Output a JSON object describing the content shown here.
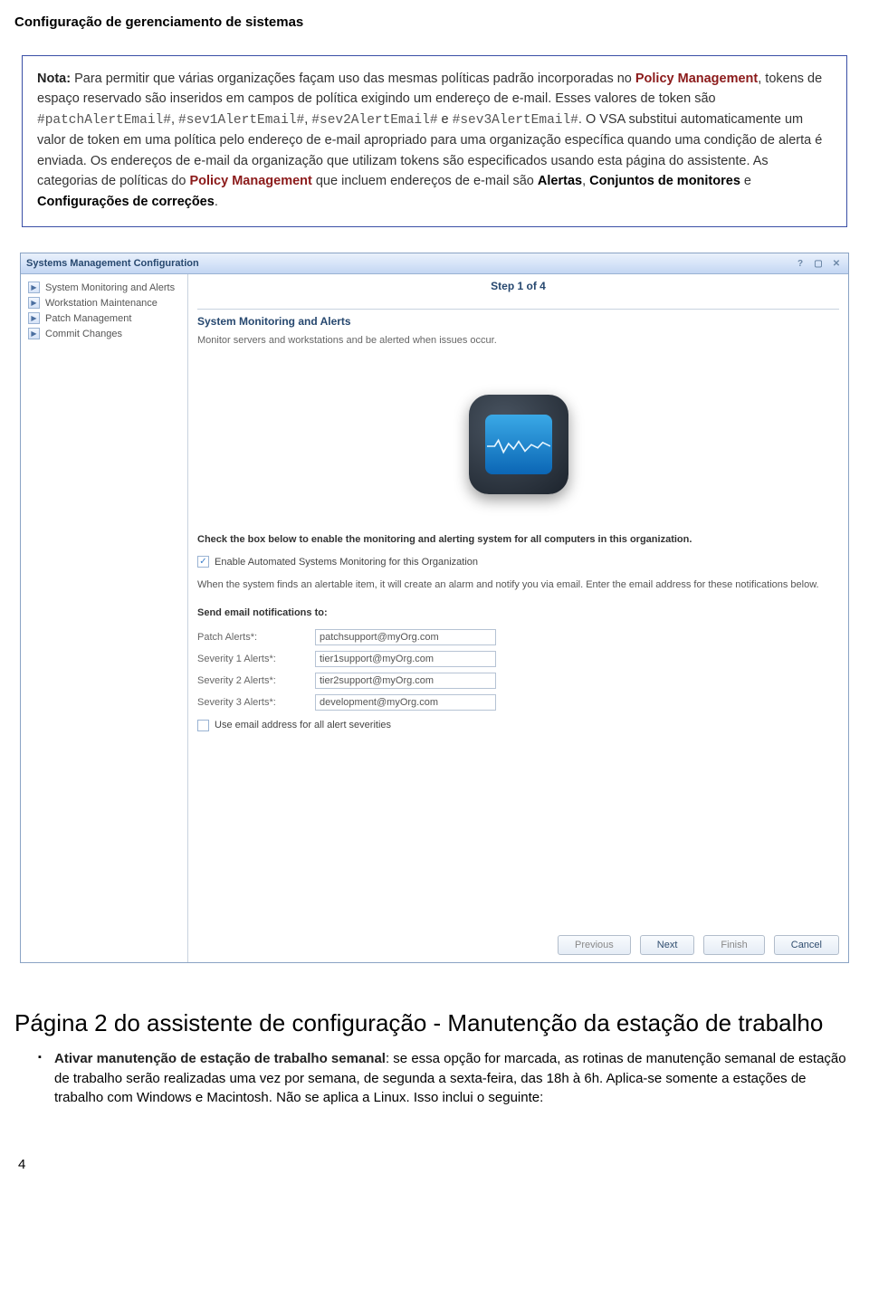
{
  "header_title": "Configuração de gerenciamento de sistemas",
  "note": {
    "label": "Nota:",
    "part1": " Para permitir que várias organizações façam uso das mesmas políticas padrão incorporadas no ",
    "policy_mgmt": "Policy Management",
    "part2": ", tokens de espaço reservado são inseridos em campos de política exigindo um endereço de e-mail. Esses valores de token são ",
    "t1": "#patchAlertEmail#",
    "c1": ", ",
    "t2": "#sev1AlertEmail#",
    "c2": ", ",
    "t3": "#sev2AlertEmail#",
    "e_word": " e ",
    "t4": "#sev3AlertEmail#",
    "part3": ". O VSA substitui automaticamente um valor de token em uma política pelo endereço de e-mail apropriado para uma organização específica quando uma condição de alerta é enviada. Os endereços de e-mail da organização que utilizam tokens são especificados usando esta página do assistente. As categorias de políticas do ",
    "policy_mgmt2": "Policy Management",
    "part4": " que incluem endereços de e-mail são ",
    "b1": "Alertas",
    "c3": ", ",
    "b2": "Conjuntos de monitores",
    "e_word2": " e ",
    "b3": "Configurações de correções",
    "dot": "."
  },
  "wizard": {
    "title": "Systems Management Configuration",
    "side": {
      "items": [
        {
          "label": "System Monitoring and Alerts"
        },
        {
          "label": "Workstation Maintenance"
        },
        {
          "label": "Patch Management"
        },
        {
          "label": "Commit Changes"
        }
      ]
    },
    "step": "Step 1 of 4",
    "section_title": "System Monitoring and Alerts",
    "desc": "Monitor servers and workstations and be alerted when issues occur.",
    "subhead": "Check the box below to enable the monitoring and alerting system for all computers in this organization.",
    "enable_checkbox_checked": "✓",
    "enable_label": "Enable Automated Systems Monitoring for this Organization",
    "notify_text": "When the system finds an alertable item, it will create an alarm and notify you via email. Enter the email address for these notifications below.",
    "send_head": "Send email notifications to:",
    "rows": [
      {
        "label": "Patch Alerts*:",
        "value": "patchsupport@myOrg.com"
      },
      {
        "label": "Severity 1 Alerts*:",
        "value": "tier1support@myOrg.com"
      },
      {
        "label": "Severity 2 Alerts*:",
        "value": "tier2support@myOrg.com"
      },
      {
        "label": "Severity 3 Alerts*:",
        "value": "development@myOrg.com"
      }
    ],
    "use_all_label": "Use email address for all alert severities",
    "buttons": {
      "previous": "Previous",
      "next": "Next",
      "finish": "Finish",
      "cancel": "Cancel"
    }
  },
  "section2": {
    "title": "Página 2 do assistente de configuração - Manutenção da estação de trabalho",
    "label": "Ativar manutenção de estação de trabalho semanal",
    "text": ": se essa opção for marcada, as rotinas de manutenção semanal de estação de trabalho serão realizadas uma vez por semana, de segunda a sexta-feira, das 18h à 6h. Aplica-se somente a estações de trabalho com Windows e Macintosh. Não se aplica a Linux. Isso inclui o seguinte:"
  },
  "page_number": "4"
}
